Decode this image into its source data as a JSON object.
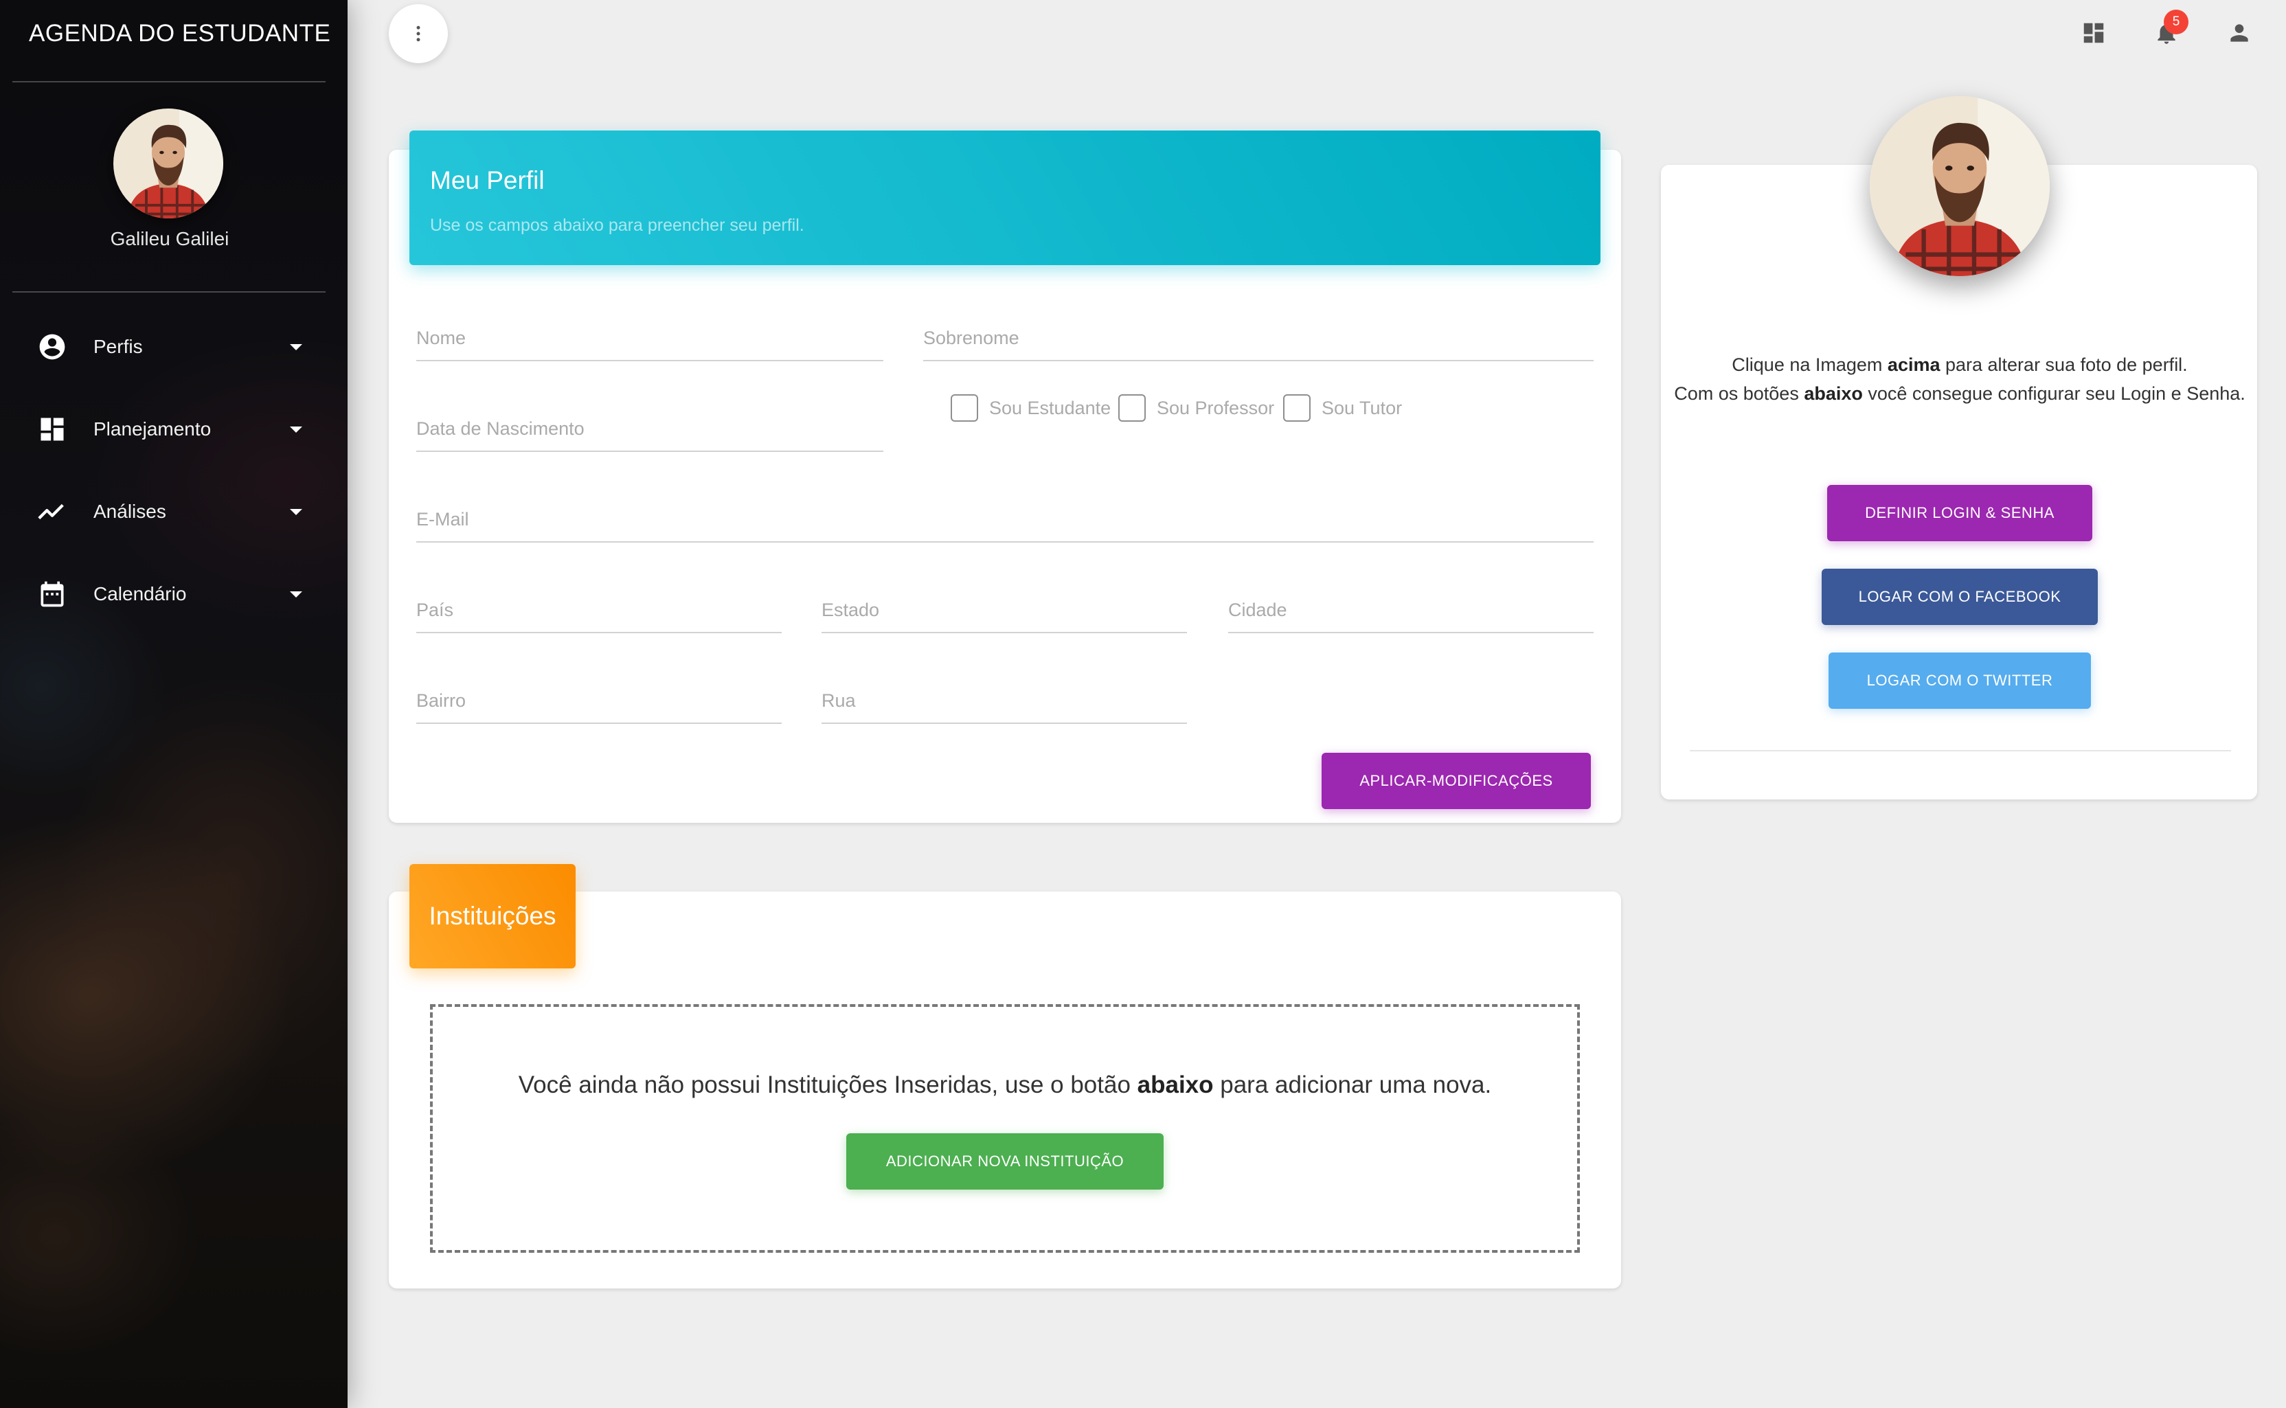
{
  "sidebar": {
    "brand": "AGENDA DO ESTUDANTE",
    "user_name": "Galileu Galilei",
    "items": [
      {
        "label": "Perfis",
        "icon": "account-circle-icon"
      },
      {
        "label": "Planejamento",
        "icon": "dashboard-icon"
      },
      {
        "label": "Análises",
        "icon": "trending-up-icon"
      },
      {
        "label": "Calendário",
        "icon": "calendar-icon"
      }
    ]
  },
  "topbar": {
    "notification_count": "5",
    "icons": [
      "more-vert-icon",
      "dashboard-icon",
      "notifications-icon",
      "person-icon"
    ]
  },
  "profile": {
    "title": "Meu Perfil",
    "subtitle": "Use os campos abaixo para preencher seu perfil.",
    "fields": {
      "nome": "Nome",
      "sobrenome": "Sobrenome",
      "nascimento": "Data de Nascimento",
      "email": "E-Mail",
      "pais": "País",
      "estado": "Estado",
      "cidade": "Cidade",
      "bairro": "Bairro",
      "rua": "Rua"
    },
    "checkboxes": {
      "estudante": "Sou Estudante",
      "professor": "Sou Professor",
      "tutor": "Sou Tutor"
    },
    "apply_label": "APLICAR-MODIFICAÇÕES"
  },
  "instituicoes": {
    "title": "Instituições",
    "empty_pre": "Você ainda não possui Instituições Inseridas, use o botão ",
    "empty_bold": "abaixo",
    "empty_post": " para adicionar uma nova.",
    "add_label": "ADICIONAR NOVA INSTITUIÇÃO"
  },
  "profile_side": {
    "desc_1": "Clique na Imagem ",
    "desc_1_bold": "acima",
    "desc_2": " para alterar sua foto de perfil.",
    "desc_3": "Com os botões ",
    "desc_3_bold": "abaixo",
    "desc_4": " você consegue configurar seu Login e Senha.",
    "btn_login": "DEFINIR LOGIN & SENHA",
    "btn_facebook": "LOGAR COM O FACEBOOK",
    "btn_twitter": "LOGAR COM O TWITTER"
  },
  "colors": {
    "cyan": "#00acc1",
    "orange": "#fb8c00",
    "purple": "#9c27b0",
    "facebook": "#3b5998",
    "twitter": "#55acee",
    "green": "#4caf50",
    "badge": "#f44336"
  }
}
